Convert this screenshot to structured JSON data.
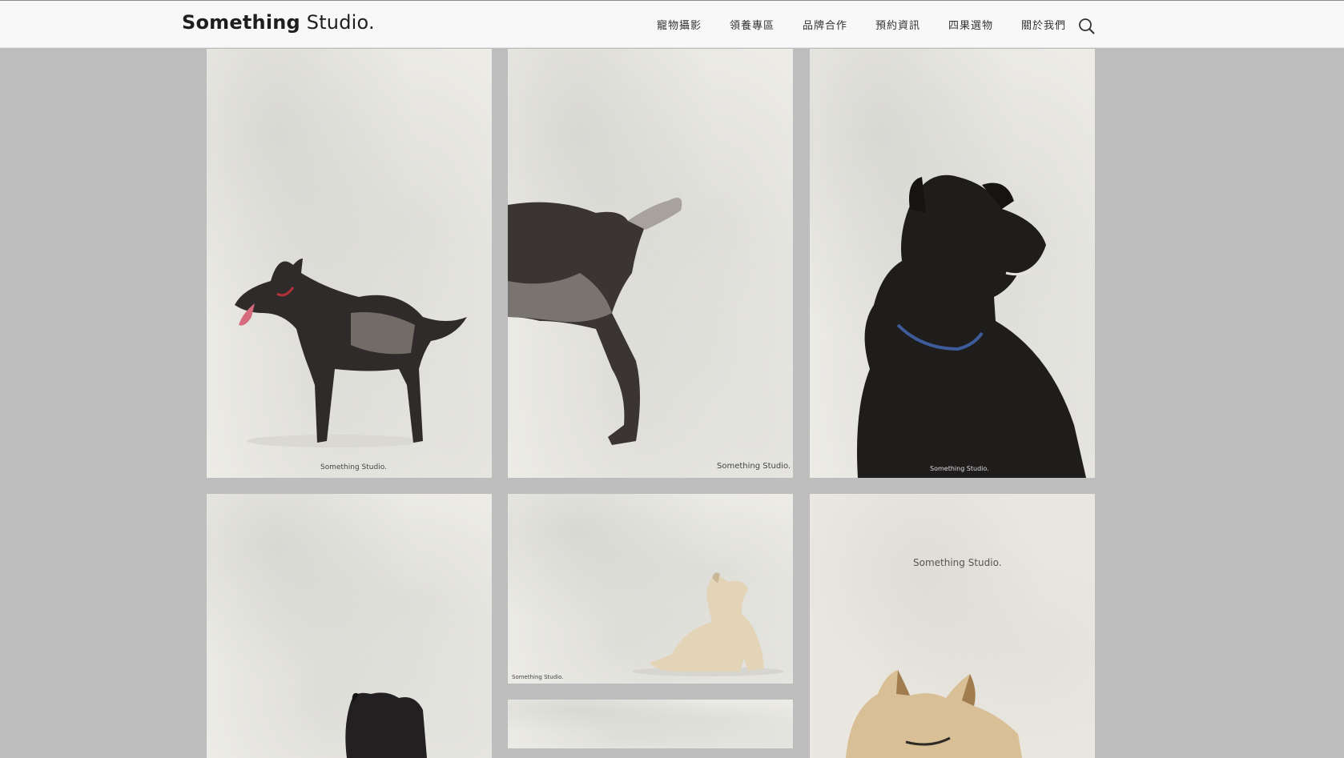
{
  "header": {
    "logo_bold": "Something",
    "logo_light": "Studio.",
    "nav": [
      "寵物攝影",
      "領養專區",
      "品牌合作",
      "預約資訊",
      "四果選物",
      "關於我們"
    ],
    "search_icon": "search-icon"
  },
  "gallery": {
    "watermark": "Something Studio.",
    "tiles": [
      {
        "subject": "black and grey dog standing, side view"
      },
      {
        "subject": "rear half of grey spotted dog"
      },
      {
        "subject": "black dog portrait with blue collar"
      },
      {
        "subject": "black dog partially visible at bottom"
      },
      {
        "subject": "cream dog sitting"
      },
      {
        "subject": "next photo partially visible"
      },
      {
        "subject": "tan dog face partially visible"
      }
    ]
  },
  "colors": {
    "page_bg": "#bdbdbd",
    "header_bg": "#f8f8f8",
    "photo_bg": "#ecebe6"
  }
}
